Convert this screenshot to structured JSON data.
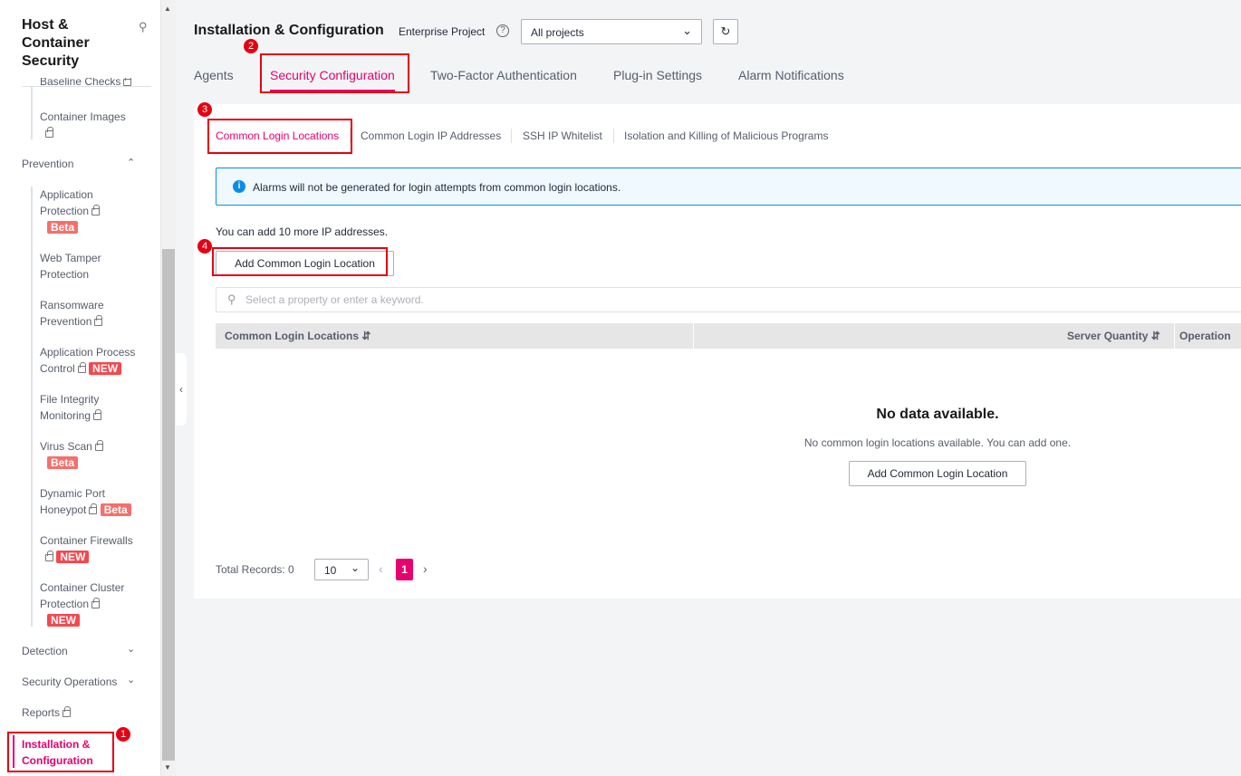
{
  "sidebar": {
    "title": "Host & Container Security",
    "partial_item": "Baseline Checks",
    "container_images": "Container Images",
    "prevention": "Prevention",
    "items": [
      {
        "label1": "Application",
        "label2": "Protection",
        "badge": "Beta"
      },
      {
        "label1": "Web Tamper",
        "label2": "Protection"
      },
      {
        "label1": "Ransomware",
        "label2": "Prevention"
      },
      {
        "label1": "Application Process",
        "label2": "Control",
        "badge": "NEW"
      },
      {
        "label1": "File Integrity",
        "label2": "Monitoring"
      },
      {
        "label1": "Virus Scan",
        "badge": "Beta"
      },
      {
        "label1": "Dynamic Port",
        "label2": "Honeypot",
        "badge": "Beta"
      },
      {
        "label1": "Container Firewalls",
        "badge": "NEW"
      },
      {
        "label1": "Container Cluster",
        "label2": "Protection",
        "badge": "NEW"
      }
    ],
    "detection": "Detection",
    "security_operations": "Security Operations",
    "reports": "Reports",
    "installation": "Installation & Configuration"
  },
  "header": {
    "title": "Installation & Configuration",
    "enterprise_project_label": "Enterprise Project",
    "project_select": "All projects"
  },
  "tabs": [
    "Agents",
    "Security Configuration",
    "Two-Factor Authentication",
    "Plug-in Settings",
    "Alarm Notifications"
  ],
  "subtabs": [
    "Common Login Locations",
    "Common Login IP Addresses",
    "SSH IP Whitelist",
    "Isolation and Killing of Malicious Programs"
  ],
  "info": "Alarms will not be generated for login attempts from common login locations.",
  "quota": "You can add 10 more IP addresses.",
  "add_button": "Add Common Login Location",
  "search_placeholder": "Select a property or enter a keyword.",
  "table": {
    "columns": [
      "Common Login Locations",
      "Server Quantity",
      "Operation"
    ]
  },
  "empty": {
    "title": "No data available.",
    "text": "No common login locations available. You can add one.",
    "button": "Add Common Login Location"
  },
  "pagination": {
    "total": "Total Records: 0",
    "page_size": "10",
    "current_page": "1"
  },
  "steps": [
    "1",
    "2",
    "3",
    "4"
  ],
  "colors": {
    "accent": "#e8006f",
    "annotation": "#e60012",
    "info": "#0c8ce9"
  }
}
